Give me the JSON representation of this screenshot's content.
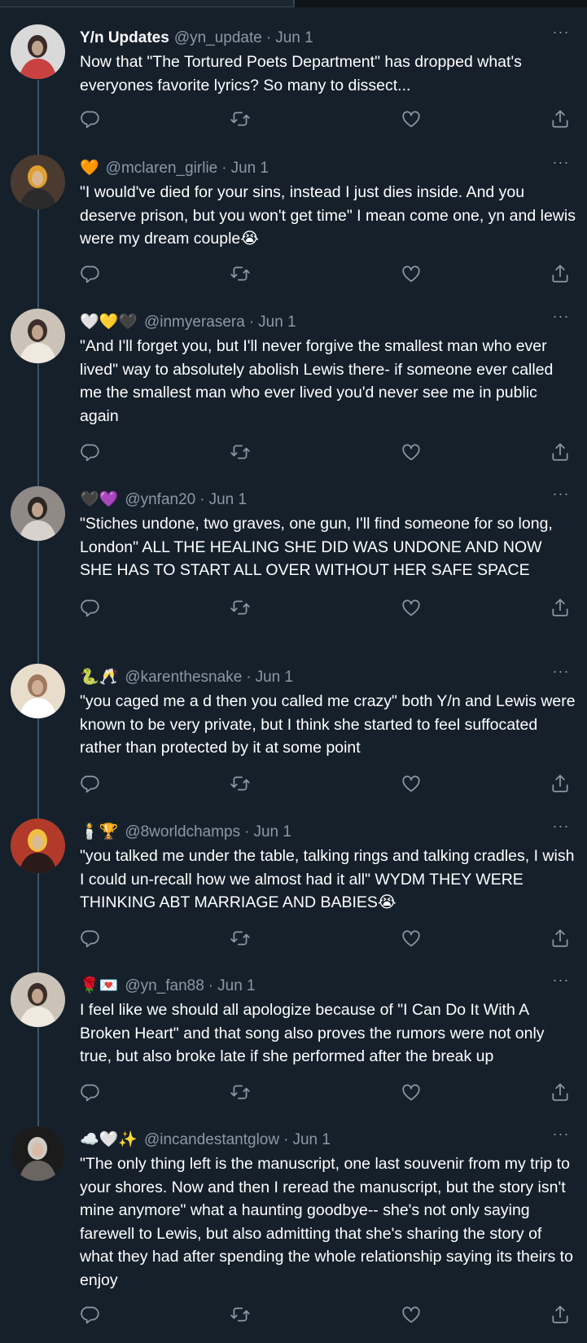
{
  "colors": {
    "background": "#15202b",
    "text": "#ffffff",
    "secondary": "#8b98a5",
    "thread_line": "#3d5466"
  },
  "tweets": [
    {
      "display_name": "Y/n Updates",
      "handle": "@yn_update",
      "time": "Jun 1",
      "emojis": "",
      "text": "Now that \"The Tortured Poets Department\" has dropped what's everyones favorite lyrics? So many to dissect..."
    },
    {
      "display_name": "",
      "handle": "@mclaren_girlie",
      "time": "Jun 1",
      "emojis": "🧡",
      "text": "\"I would've died for your sins, instead I just dies inside. And you deserve prison, but you won't get time\" I mean come one, yn and lewis were my dream couple😭"
    },
    {
      "display_name": "",
      "handle": "@inmyerasera",
      "time": "Jun 1",
      "emojis": "🤍💛🖤",
      "text": "\"And I'll forget you, but I'll never forgive the smallest man who ever lived\" way to absolutely abolish Lewis there- if someone ever called me the smallest man who ever lived you'd never see me in public again"
    },
    {
      "display_name": "",
      "handle": "@ynfan20",
      "time": "Jun 1",
      "emojis": "🖤💜",
      "text": "\"Stiches undone, two graves, one gun, I'll find someone for so long, London\" ALL THE HEALING SHE DID WAS UNDONE AND NOW SHE HAS TO START ALL OVER WITHOUT HER SAFE SPACE"
    },
    {
      "display_name": "",
      "handle": "@karenthesnake",
      "time": "Jun 1",
      "emojis": "🐍🥂",
      "text": "\"you caged me a d then you called me crazy\" both Y/n and Lewis were known to be very private, but I think she started to feel suffocated rather than protected by it at some point"
    },
    {
      "display_name": "",
      "handle": "@8worldchamps",
      "time": "Jun 1",
      "emojis": "🕯️🏆",
      "text": "\"you talked me under the table, talking rings and talking cradles, I wish I could un-recall how we almost had it all\" WYDM THEY WERE THINKING ABT MARRIAGE AND BABIES😭"
    },
    {
      "display_name": "",
      "handle": "@yn_fan88",
      "time": "Jun 1",
      "emojis": "🌹💌",
      "text": "I feel like we should all apologize because of \"I Can Do It With A Broken Heart\" and that song also proves the rumors were not only true, but also broke late if she performed after the break up"
    },
    {
      "display_name": "",
      "handle": "@incandestantglow",
      "time": "Jun 1",
      "emojis": "☁️🤍✨",
      "text": "\"The only thing left is the manuscript, one last souvenir from my trip to your shores. Now and then I reread the manuscript, but the story isn't mine anymore\" what a haunting goodbye-- she's not only saying farewell to Lewis, but also admitting that she's sharing the story of what they had after spending the whole relationship saying its theirs to enjoy"
    }
  ],
  "separator": "·",
  "icons": {
    "reply": "reply-icon",
    "retweet": "retweet-icon",
    "like": "heart-icon",
    "share": "share-icon",
    "more": "more-icon"
  }
}
